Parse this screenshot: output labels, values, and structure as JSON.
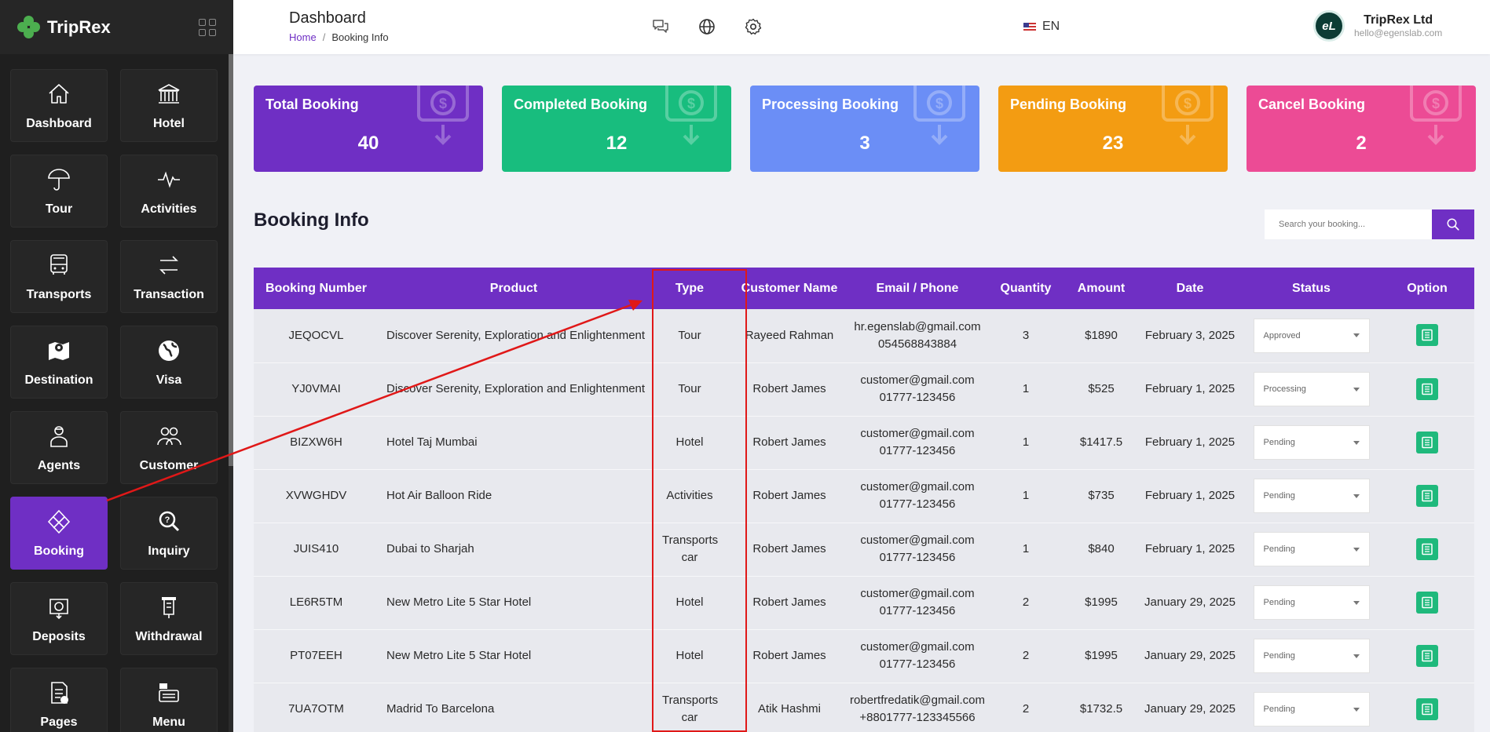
{
  "brand": {
    "name": "TripRex"
  },
  "sidebar": {
    "items": [
      {
        "label": "Dashboard",
        "icon": "home-icon"
      },
      {
        "label": "Hotel",
        "icon": "hotel-icon"
      },
      {
        "label": "Tour",
        "icon": "umbrella-icon"
      },
      {
        "label": "Activities",
        "icon": "activity-icon"
      },
      {
        "label": "Transports",
        "icon": "bus-icon"
      },
      {
        "label": "Transaction",
        "icon": "transfer-icon"
      },
      {
        "label": "Destination",
        "icon": "map-pin-icon"
      },
      {
        "label": "Visa",
        "icon": "globe-icon"
      },
      {
        "label": "Agents",
        "icon": "agent-icon"
      },
      {
        "label": "Customer",
        "icon": "users-icon"
      },
      {
        "label": "Booking",
        "icon": "booking-icon",
        "active": true
      },
      {
        "label": "Inquiry",
        "icon": "inquiry-icon"
      },
      {
        "label": "Deposits",
        "icon": "deposit-icon"
      },
      {
        "label": "Withdrawal",
        "icon": "withdrawal-icon"
      },
      {
        "label": "Pages",
        "icon": "pages-icon"
      },
      {
        "label": "Menu",
        "icon": "menu-icon"
      }
    ]
  },
  "header": {
    "title": "Dashboard",
    "breadcrumb": {
      "home": "Home",
      "separator": "/",
      "current": "Booking Info"
    },
    "language": "EN",
    "user": {
      "name": "TripRex Ltd",
      "email": "hello@egenslab.com",
      "avatar_text": "eL"
    }
  },
  "stats": [
    {
      "label": "Total Booking",
      "value": "40",
      "color": "#6f2fc4"
    },
    {
      "label": "Completed Booking",
      "value": "12",
      "color": "#18bd7e"
    },
    {
      "label": "Processing Booking",
      "value": "3",
      "color": "#6b8ef6"
    },
    {
      "label": "Pending Booking",
      "value": "23",
      "color": "#f39c12"
    },
    {
      "label": "Cancel Booking",
      "value": "2",
      "color": "#ec4b95"
    }
  ],
  "booking": {
    "title": "Booking Info",
    "search_placeholder": "Search your booking...",
    "columns": [
      "Booking Number",
      "Product",
      "Type",
      "Customer Name",
      "Email / Phone",
      "Quantity",
      "Amount",
      "Date",
      "Status",
      "Option"
    ],
    "rows": [
      {
        "number": "JEQOCVL",
        "product": "Discover Serenity, Exploration and Enlightenment",
        "type": "Tour",
        "customer": "Rayeed Rahman",
        "email": "hr.egenslab@gmail.com",
        "phone": "054568843884",
        "quantity": "3",
        "amount": "$1890",
        "date": "February 3, 2025",
        "status": "Approved"
      },
      {
        "number": "YJ0VMAI",
        "product": "Discover Serenity, Exploration and Enlightenment",
        "type": "Tour",
        "customer": "Robert James",
        "email": "customer@gmail.com",
        "phone": "01777-123456",
        "quantity": "1",
        "amount": "$525",
        "date": "February 1, 2025",
        "status": "Processing"
      },
      {
        "number": "BIZXW6H",
        "product": "Hotel Taj Mumbai",
        "type": "Hotel",
        "customer": "Robert James",
        "email": "customer@gmail.com",
        "phone": "01777-123456",
        "quantity": "1",
        "amount": "$1417.5",
        "date": "February 1, 2025",
        "status": "Pending"
      },
      {
        "number": "XVWGHDV",
        "product": "Hot Air Balloon Ride",
        "type": "Activities",
        "customer": "Robert James",
        "email": "customer@gmail.com",
        "phone": "01777-123456",
        "quantity": "1",
        "amount": "$735",
        "date": "February 1, 2025",
        "status": "Pending"
      },
      {
        "number": "JUIS410",
        "product": "Dubai to Sharjah",
        "type": "Transports car",
        "customer": "Robert James",
        "email": "customer@gmail.com",
        "phone": "01777-123456",
        "quantity": "1",
        "amount": "$840",
        "date": "February 1, 2025",
        "status": "Pending"
      },
      {
        "number": "LE6R5TM",
        "product": "New Metro Lite 5 Star Hotel",
        "type": "Hotel",
        "customer": "Robert James",
        "email": "customer@gmail.com",
        "phone": "01777-123456",
        "quantity": "2",
        "amount": "$1995",
        "date": "January 29, 2025",
        "status": "Pending"
      },
      {
        "number": "PT07EEH",
        "product": "New Metro Lite 5 Star Hotel",
        "type": "Hotel",
        "customer": "Robert James",
        "email": "customer@gmail.com",
        "phone": "01777-123456",
        "quantity": "2",
        "amount": "$1995",
        "date": "January 29, 2025",
        "status": "Pending"
      },
      {
        "number": "7UA7OTM",
        "product": "Madrid To Barcelona",
        "type": "Transports car",
        "customer": "Atik Hashmi",
        "email": "robertfredatik@gmail.com",
        "phone": "+8801777-123345566",
        "quantity": "2",
        "amount": "$1732.5",
        "date": "January 29, 2025",
        "status": "Pending"
      }
    ]
  },
  "annotation": {
    "color": "#e01818"
  }
}
